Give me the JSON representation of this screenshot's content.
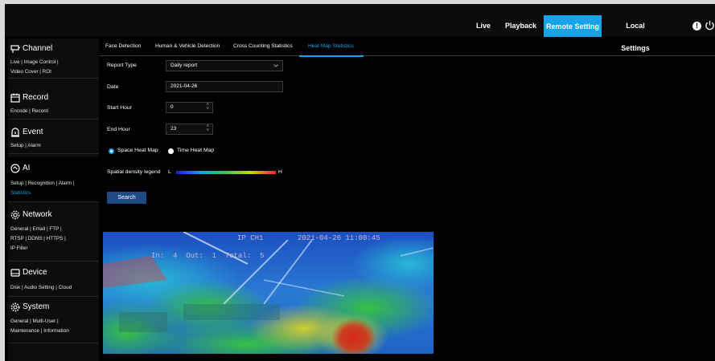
{
  "topbar": {
    "nav": [
      "Live",
      "Playback",
      "Remote Setting",
      "Local Settings"
    ],
    "active": "Remote Setting"
  },
  "sidebar": {
    "sections": [
      {
        "title": "Channel",
        "icon": "channel-icon",
        "links": [
          "Live | Image Control |",
          "Video Cover | ROI"
        ]
      },
      {
        "title": "Record",
        "icon": "record-icon",
        "links": [
          "Encode | Record"
        ]
      },
      {
        "title": "Event",
        "icon": "event-icon",
        "links": [
          "Setup | Alarm"
        ]
      },
      {
        "title": "AI",
        "icon": "ai-icon",
        "links": [
          "Setup | Recognition | Alarm |",
          "Statistics"
        ]
      },
      {
        "title": "Network",
        "icon": "network-icon",
        "links": [
          "General | Email | FTP |",
          "RTSP | DDNS | HTTPS |",
          "IP Filter"
        ]
      },
      {
        "title": "Device",
        "icon": "device-icon",
        "links": [
          "Disk | Audio Setting | Cloud"
        ]
      },
      {
        "title": "System",
        "icon": "system-icon",
        "links": [
          "General | Multi-User |",
          "Maintenance | Information"
        ]
      }
    ]
  },
  "tabs": {
    "items": [
      "Face Detection",
      "Human & Vehicle Detection",
      "Cross Counting Statistics",
      "Heat Map Statistics"
    ],
    "active": "Heat Map Statistics"
  },
  "form": {
    "report_type": {
      "label": "Report Type",
      "value": "Daily report"
    },
    "date": {
      "label": "Date",
      "value": "2021-04-26"
    },
    "start_hour": {
      "label": "Start Hour",
      "value": "0"
    },
    "end_hour": {
      "label": "End Hour",
      "value": "23"
    },
    "map_type": {
      "options": [
        "Space Heat Map",
        "Time Heat Map"
      ],
      "selected": "Space Heat Map"
    },
    "legend": {
      "label": "Spatial density legend",
      "low": "L",
      "high": "H"
    },
    "search_label": "Search"
  },
  "heatmap": {
    "channel": "IP CH1",
    "timestamp": "2021-04-26 11:00:45",
    "counter": "In:  4  Out:  1  Total:  5"
  },
  "colors": {
    "accent": "#17a3e6",
    "button": "#1f4b84"
  }
}
